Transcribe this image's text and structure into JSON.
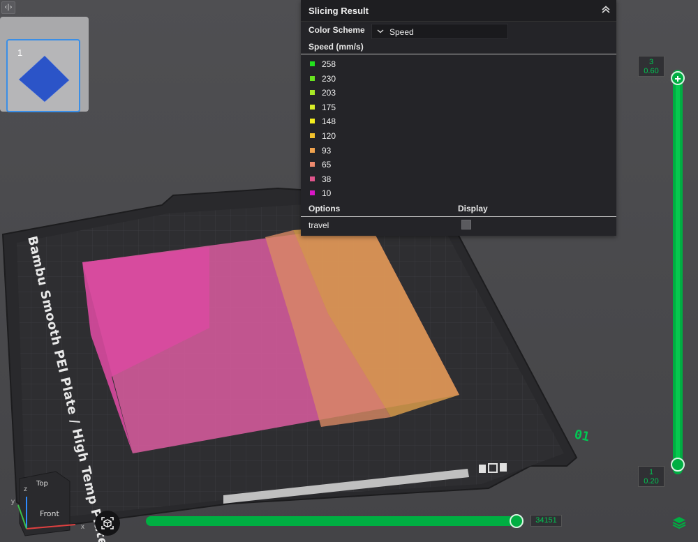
{
  "toolbar": {
    "collapse_glyph": "‹|›"
  },
  "plate_panel": {
    "plate_number": "1"
  },
  "viewport": {
    "plate_name": "Bambu Smooth PEI Plate / High Temp Plate",
    "plate_index_label": "01",
    "view_cube": {
      "top_label": "Top",
      "front_label": "Front"
    },
    "axes": {
      "x": "x",
      "y": "y",
      "z": "z"
    },
    "accent_color": "#00ae42"
  },
  "slicing_result": {
    "title": "Slicing Result",
    "color_scheme_label": "Color Scheme",
    "color_scheme_value": "Speed",
    "legend_title": "Speed (mm/s)",
    "legend": [
      {
        "label": "258",
        "color": "#22e21d"
      },
      {
        "label": "230",
        "color": "#68e31f"
      },
      {
        "label": "203",
        "color": "#a8e826"
      },
      {
        "label": "175",
        "color": "#d8ee28"
      },
      {
        "label": "148",
        "color": "#f4ee1e"
      },
      {
        "label": "120",
        "color": "#f2c22d"
      },
      {
        "label": "93",
        "color": "#f0a34f"
      },
      {
        "label": "65",
        "color": "#ee8a6e"
      },
      {
        "label": "38",
        "color": "#e0558c"
      },
      {
        "label": "10",
        "color": "#d916c6"
      }
    ],
    "options_header": "Options",
    "display_header": "Display",
    "options": [
      {
        "label": "travel",
        "checked": false
      }
    ]
  },
  "layer_slider": {
    "top": {
      "layer": "3",
      "height": "0.60"
    },
    "bottom": {
      "layer": "1",
      "height": "0.20"
    }
  },
  "move_slider": {
    "value": "34151"
  }
}
